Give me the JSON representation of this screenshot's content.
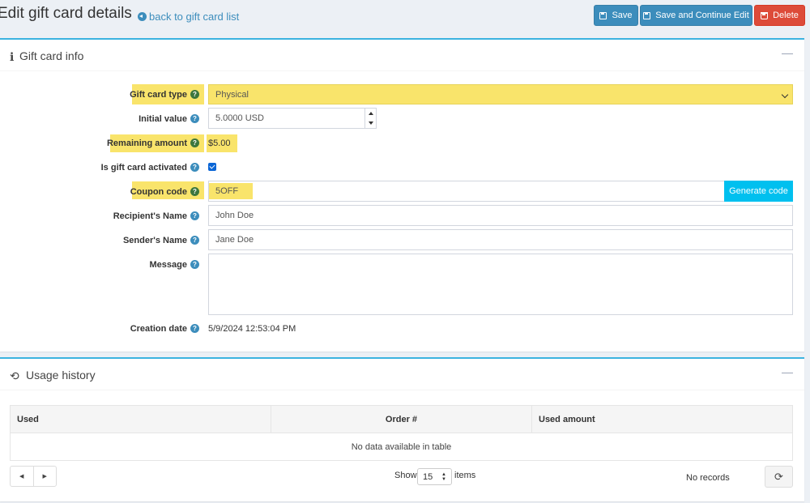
{
  "header": {
    "title": "Edit gift card details",
    "back_link": "back to gift card list",
    "save_label": "Save",
    "save_continue_label": "Save and Continue Edit",
    "delete_label": "Delete"
  },
  "gift_card_info": {
    "title": "Gift card info",
    "fields": {
      "type_label": "Gift card type",
      "type_value": "Physical",
      "initial_value_label": "Initial value",
      "initial_value": "5.0000 USD",
      "remaining_label": "Remaining amount",
      "remaining_value": "$5.00",
      "activated_label": "Is gift card activated",
      "activated": true,
      "coupon_label": "Coupon code",
      "coupon_value": "5OFF",
      "generate_label": "Generate code",
      "recipient_label": "Recipient's Name",
      "recipient_value": "John Doe",
      "sender_label": "Sender's Name",
      "sender_value": "Jane Doe",
      "message_label": "Message",
      "message_value": "",
      "creation_label": "Creation date",
      "creation_value": "5/9/2024 12:53:04 PM"
    }
  },
  "usage_history": {
    "title": "Usage history",
    "columns": [
      "Used",
      "Order #",
      "Used amount"
    ],
    "empty_text": "No data available in table",
    "show_label": "Show",
    "page_size": "15",
    "items_label": "items",
    "no_records": "No records"
  },
  "icons": {
    "info": "info-icon",
    "history": "history-icon",
    "help": "question-circle-icon",
    "refresh": "refresh-icon"
  },
  "colors": {
    "primary": "#3c8dbc",
    "danger": "#dd4b39",
    "info": "#00c0ef",
    "highlight": "#f9e46b",
    "card_border": "#3cb3e0"
  }
}
